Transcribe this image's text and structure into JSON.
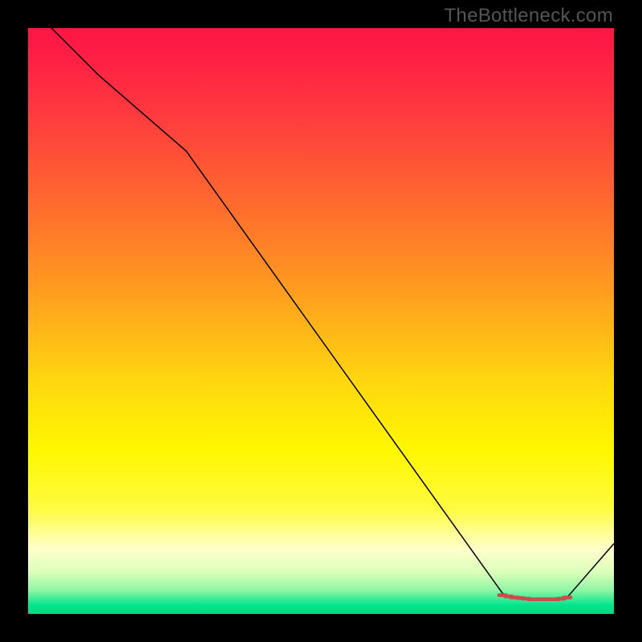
{
  "watermark": "TheBottleneck.com",
  "gradient_stops": [
    {
      "offset": 0.0,
      "color": "#ff1744"
    },
    {
      "offset": 0.03,
      "color": "#ff1a46"
    },
    {
      "offset": 0.15,
      "color": "#ff3b3e"
    },
    {
      "offset": 0.3,
      "color": "#ff6a2e"
    },
    {
      "offset": 0.45,
      "color": "#ff9d1e"
    },
    {
      "offset": 0.6,
      "color": "#ffd60f"
    },
    {
      "offset": 0.72,
      "color": "#fff700"
    },
    {
      "offset": 0.82,
      "color": "#fffb40"
    },
    {
      "offset": 0.89,
      "color": "#ffffcc"
    },
    {
      "offset": 0.93,
      "color": "#d9ffb8"
    },
    {
      "offset": 0.96,
      "color": "#8ef5a5"
    },
    {
      "offset": 0.985,
      "color": "#00e68c"
    },
    {
      "offset": 1.0,
      "color": "#00d97f"
    }
  ],
  "chart_data": {
    "type": "line",
    "title": "",
    "xlabel": "",
    "ylabel": "",
    "xlim": [
      0,
      100
    ],
    "ylim": [
      0,
      100
    ],
    "series": [
      {
        "name": "main-curve",
        "color": "#000000",
        "width": 1.5,
        "x": [
          0,
          12,
          27,
          81,
          82,
          84,
          86,
          88,
          90,
          91,
          92,
          100
        ],
        "y": [
          104,
          92,
          79,
          3.5,
          3.0,
          2.7,
          2.5,
          2.5,
          2.5,
          2.6,
          2.8,
          12
        ]
      },
      {
        "name": "trough-markers",
        "color": "#cc4b4b",
        "width": 4.5,
        "render": "stepped-segments",
        "x": [
          81,
          82,
          83,
          84,
          85,
          86,
          87,
          88,
          89,
          90,
          91,
          92
        ],
        "y": [
          3.2,
          3.0,
          2.8,
          2.7,
          2.6,
          2.5,
          2.5,
          2.5,
          2.5,
          2.5,
          2.6,
          2.8
        ]
      }
    ]
  }
}
